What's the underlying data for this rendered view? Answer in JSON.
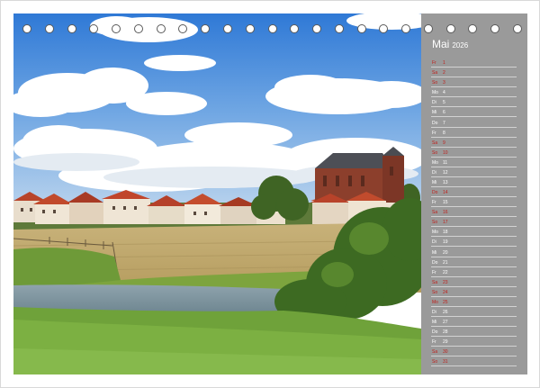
{
  "calendar": {
    "month": "Mai",
    "year": "2026",
    "days": [
      {
        "wd": "Fr",
        "d": "1",
        "red": true
      },
      {
        "wd": "Sa",
        "d": "2",
        "red": true
      },
      {
        "wd": "So",
        "d": "3",
        "red": true
      },
      {
        "wd": "Mo",
        "d": "4",
        "red": false
      },
      {
        "wd": "Di",
        "d": "5",
        "red": false
      },
      {
        "wd": "Mi",
        "d": "6",
        "red": false
      },
      {
        "wd": "Do",
        "d": "7",
        "red": false
      },
      {
        "wd": "Fr",
        "d": "8",
        "red": false
      },
      {
        "wd": "Sa",
        "d": "9",
        "red": true
      },
      {
        "wd": "So",
        "d": "10",
        "red": true
      },
      {
        "wd": "Mo",
        "d": "11",
        "red": false
      },
      {
        "wd": "Di",
        "d": "12",
        "red": false
      },
      {
        "wd": "Mi",
        "d": "13",
        "red": false
      },
      {
        "wd": "Do",
        "d": "14",
        "red": true
      },
      {
        "wd": "Fr",
        "d": "15",
        "red": false
      },
      {
        "wd": "Sa",
        "d": "16",
        "red": true
      },
      {
        "wd": "So",
        "d": "17",
        "red": true
      },
      {
        "wd": "Mo",
        "d": "18",
        "red": false
      },
      {
        "wd": "Di",
        "d": "19",
        "red": false
      },
      {
        "wd": "Mi",
        "d": "20",
        "red": false
      },
      {
        "wd": "Do",
        "d": "21",
        "red": false
      },
      {
        "wd": "Fr",
        "d": "22",
        "red": false
      },
      {
        "wd": "Sa",
        "d": "23",
        "red": true
      },
      {
        "wd": "So",
        "d": "24",
        "red": true
      },
      {
        "wd": "Mo",
        "d": "25",
        "red": true
      },
      {
        "wd": "Di",
        "d": "26",
        "red": false
      },
      {
        "wd": "Mi",
        "d": "27",
        "red": false
      },
      {
        "wd": "Do",
        "d": "28",
        "red": false
      },
      {
        "wd": "Fr",
        "d": "29",
        "red": false
      },
      {
        "wd": "Sa",
        "d": "30",
        "red": true
      },
      {
        "wd": "So",
        "d": "31",
        "red": true
      }
    ]
  },
  "colors": {
    "panel": "#9a9a9a",
    "weekend_red": "#c0201c",
    "day_text": "#ffffff"
  },
  "binding": {
    "hole_count": 23
  }
}
